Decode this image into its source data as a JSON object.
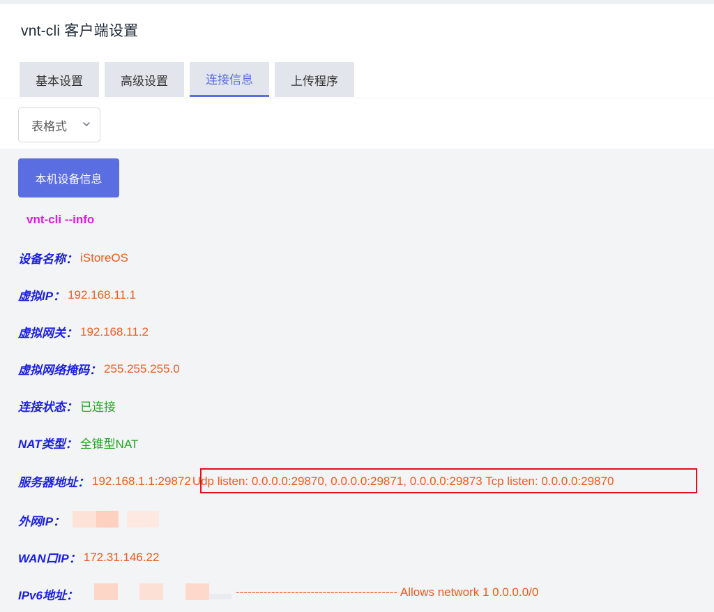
{
  "header": {
    "title": "vnt-cli 客户端设置"
  },
  "tabs": [
    {
      "label": "基本设置"
    },
    {
      "label": "高级设置"
    },
    {
      "label": "连接信息"
    },
    {
      "label": "上传程序"
    }
  ],
  "format_select": {
    "value": "表格式"
  },
  "device_info_button": {
    "label": "本机设备信息"
  },
  "command": "vnt-cli --info",
  "info": {
    "device_name": {
      "label": "设备名称：",
      "value": "iStoreOS"
    },
    "virtual_ip": {
      "label": "虚拟IP：",
      "value": "192.168.11.1"
    },
    "virtual_gateway": {
      "label": "虚拟网关：",
      "value": "192.168.11.2"
    },
    "virtual_netmask": {
      "label": "虚拟网络掩码：",
      "value": "255.255.255.0"
    },
    "connection_status": {
      "label": "连接状态：",
      "value": "已连接"
    },
    "nat_type": {
      "label": "NAT类型：",
      "value": "全锥型NAT"
    },
    "server_address": {
      "label": "服务器地址：",
      "value": "192.168.1.1:29872",
      "listen": "Udp listen: 0.0.0.0:29870, 0.0.0.0:29871, 0.0.0.0:29873 Tcp listen: 0.0.0.0:29870"
    },
    "public_ip": {
      "label": "外网IP："
    },
    "wan_ip": {
      "label": "WAN口IP：",
      "value": "172.31.146.22"
    },
    "ipv6": {
      "label": "IPv6地址：",
      "route": "----------------------------------------- Allows network 1 0.0.0.0/0"
    }
  },
  "colors": {
    "accent": "#5b6ee1",
    "label_blue": "#1a1ee0",
    "value_orange": "#f05a1a",
    "value_green": "#1fa51f",
    "command_magenta": "#e317e3",
    "highlight_red": "#e0101a"
  },
  "icons": {
    "select_chevron": "chevron-down-icon"
  }
}
